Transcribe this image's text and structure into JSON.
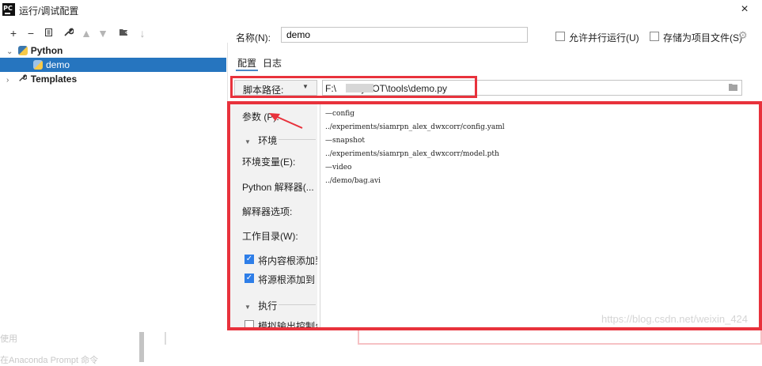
{
  "window": {
    "title": "运行/调试配置",
    "logo": "PC",
    "close_glyph": "×"
  },
  "toolbar": {
    "icons": [
      "plus-icon",
      "minus-icon",
      "copy-icon",
      "wrench-icon",
      "arrow-up-icon",
      "arrow-down-icon",
      "folder-move-icon",
      "sort-icon"
    ]
  },
  "tree": {
    "root_python": "Python",
    "child_demo": "demo",
    "templates": "Templates"
  },
  "config": {
    "name_label": "名称(N):",
    "name_value": "demo",
    "allow_parallel": "允许并行运行(U)",
    "store_as_project_file": "存储为项目文件(S)",
    "tabs": [
      "配置",
      "日志"
    ],
    "script_label": "脚本路径:",
    "script_path": "F:\\      \\PySOT\\tools\\demo.py",
    "params_label": "参数 (P):",
    "env_section": "环境",
    "env_vars_label": "环境变量(E):",
    "interpreter_label": "Python 解释器(...",
    "interpreter_opts_label": "解释器选项:",
    "workdir_label": "工作目录(W):",
    "add_content_roots": "将内容根添加到",
    "add_source_roots": "将源根添加到 P",
    "exec_section": "执行",
    "emulate_terminal": "模拟输出控制台",
    "parameters": [
      "—config",
      "../experiments/siamrpn_alex_dwxcorr/config.yaml",
      "—snapshot",
      "../experiments/siamrpn_alex_dwxcorr/model.pth",
      "—video",
      "../demo/bag.avi"
    ]
  },
  "background": {
    "text1": "使用",
    "text2": "在Anaconda Prompt 命令",
    "watermark": "https://blog.csdn.net/weixin_424"
  },
  "colors": {
    "selection": "#2675bf",
    "annotation_red": "#e8323c",
    "checkbox_blue": "#2e7ee8"
  }
}
